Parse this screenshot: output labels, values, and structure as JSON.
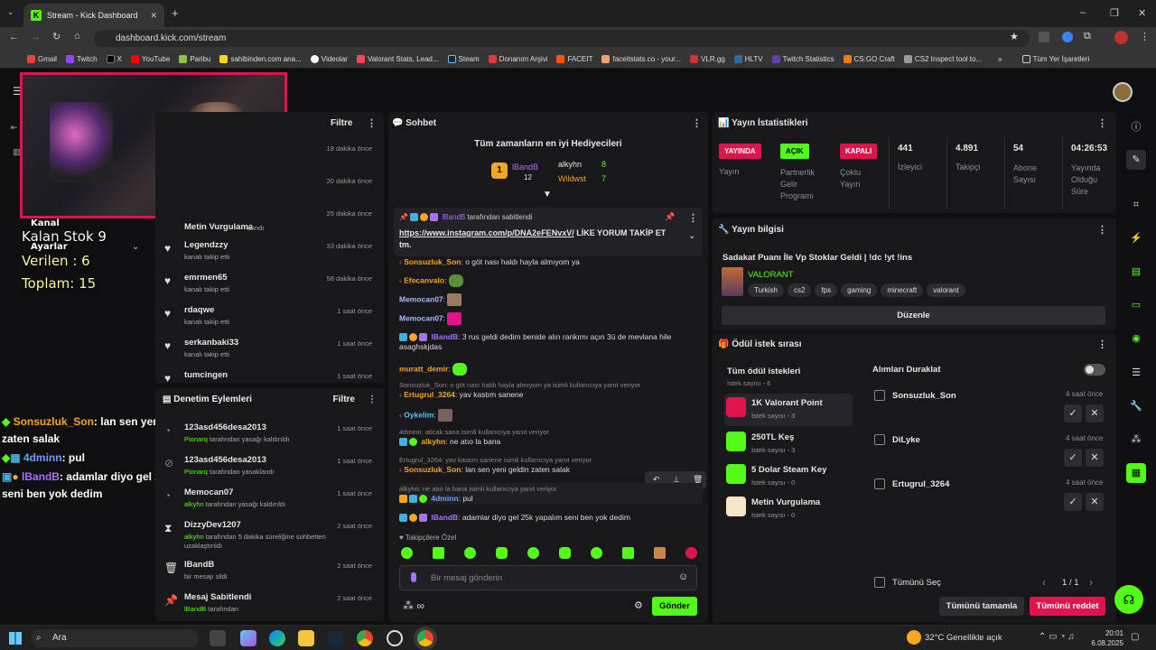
{
  "browser": {
    "tab_title": "Stream - Kick Dashboard",
    "url": "dashboard.kick.com/stream",
    "bookmarks": [
      "Gmail",
      "Twitch",
      "X",
      "YouTube",
      "Paribu",
      "sahibinden.com ana...",
      "Videolar",
      "Valorant Stats, Lead...",
      "Steam",
      "Donanım Arşivi",
      "FACEIT",
      "faceitstats.co - your...",
      "VLR.gg",
      "HLTV",
      "Twitch Statistics",
      "CS:GO Craft",
      "CS2 Inspect tool to..."
    ],
    "all_bookmarks": "Tüm Yer İşaretleri"
  },
  "overlay": {
    "kanal": "Kanal",
    "ayarlar": "Ayarlar",
    "kalan": "Kalan Stok 9",
    "verilen": "Verilen :  6",
    "toplam": "Toplam: 15",
    "chat": [
      {
        "user": "Sonsuzluk_Son",
        "msg": ": lan sen yeni geldin zaten salak"
      },
      {
        "user": "4dminn",
        "msg": ": pul"
      },
      {
        "user": "lBandB",
        "msg": ": adamlar diyo gel 25k yapalım seni ben yok dedim"
      }
    ]
  },
  "activity": {
    "filter": "Filtre",
    "rows": [
      {
        "name": "",
        "sub": "",
        "time": "18 dakika önce"
      },
      {
        "name": "",
        "sub": "",
        "time": "20 dakika önce"
      },
      {
        "name": "",
        "sub": "",
        "time": "25 dakika önce"
      },
      {
        "name": "Metin Vurgulama",
        "sub": "alındı",
        "time": ""
      },
      {
        "name": "Legendzzy",
        "sub": "kanalı takip etti",
        "time": "33 dakika önce"
      },
      {
        "name": "emrmen65",
        "sub": "kanalı takip etti",
        "time": "58 dakika önce"
      },
      {
        "name": "rdaqwe",
        "sub": "kanalı takip etti",
        "time": "1 saat önce"
      },
      {
        "name": "serkanbaki33",
        "sub": "kanalı takip etti",
        "time": "1 saat önce"
      },
      {
        "name": "tumcingen",
        "sub": "",
        "time": "1 saat önce"
      }
    ]
  },
  "moderation": {
    "title": "Denetim Eylemleri",
    "filter": "Filtre",
    "rows": [
      {
        "name": "123asd456desa2013",
        "actor": "Pionarq",
        "sub": " tarafından yasağı kaldırıldı",
        "time": "1 saat önce"
      },
      {
        "name": "123asd456desa2013",
        "actor": "Pionarq",
        "sub": " tarafından yasaklandı",
        "time": "1 saat önce"
      },
      {
        "name": "Memocan07",
        "actor": "alkyhn",
        "sub": " tarafından yasağı kaldırıldı",
        "time": "1 saat önce"
      },
      {
        "name": "DizzyDev1207",
        "actor": "alkyhn",
        "sub": " tarafından 5 dakika süreliğine sohbetten uzaklaştırıldı",
        "time": "2 saat önce"
      },
      {
        "name": "lBandB",
        "actor": "",
        "sub": "bir mesajı sildi",
        "time": "2 saat önce"
      },
      {
        "name": "Mesaj Sabitlendi",
        "actor": "lBandB",
        "sub": " tarafından",
        "time": "2 saat önce"
      }
    ]
  },
  "chat": {
    "title": "Sohbet",
    "gifters_title": "Tüm zamanların en iyi Hediyecileri",
    "gifter1": "lBandB",
    "gifter1_count": "12",
    "gifter2": "alkyhn",
    "gifter2_count": "8",
    "gifter3": "Wildwst",
    "gifter3_count": "7",
    "pinned_by": "lBandB",
    "pinned_suffix": " tarafından sabitlendi",
    "pinned_link": "https://www.instagram.com/p/DNA2eFENvxV/",
    "pinned_text": " LİKE YORUM TAKİP ET tm.",
    "messages": [
      {
        "reply": "",
        "user": "Sonsuzluk_Son",
        "text": ": o göt nası haldı hayla almıyom ya"
      },
      {
        "reply": "",
        "user": "Efecanvalo",
        "text": ":"
      },
      {
        "reply": "",
        "user": "Memocan07",
        "text": ":"
      },
      {
        "reply": "",
        "user": "Memocan07",
        "text": ":"
      },
      {
        "reply": "",
        "user": "lBandB",
        "text": ": 3 rus geldi dedim benide alın rankımı açın 3ü de mevlana hile asaghskjdas"
      },
      {
        "reply": "",
        "user": "muratt_demir",
        "text": ":"
      },
      {
        "reply": "Sonsuzluk_Son: o göt nası haldı hayla almıyom ya isimli kullanıcıya yanıt veriyor",
        "user": "Ertugrul_3264",
        "text": ": yav kastım sanene"
      },
      {
        "reply": "",
        "user": "Oykelim",
        "text": ":"
      },
      {
        "reply": "4dminn: aticak sana isimli kullanıcıya yanıt veriyor",
        "user": "alkyhn",
        "text": ": ne atıo la bana"
      },
      {
        "reply": "Ertugrul_3264: yav kastım sanene isimli kullanıcıya yanıt veriyor",
        "user": "Sonsuzluk_Son",
        "text": ": lan sen yeni geldin zaten salak"
      },
      {
        "reply": "alkyhn: ne atıo la bana isimli kullanıcıya yanıt veriyor",
        "user": "4dminn",
        "text": ": pul"
      },
      {
        "reply": "",
        "user": "lBandB",
        "text": ": adamlar diyo gel 25k yapalım seni ben yok dedim"
      }
    ],
    "followers_only": "Takipçilere Özel",
    "input_placeholder": "Bir mesaj gönderin",
    "send": "Gönder"
  },
  "stats": {
    "title": "Yayın İstatistikleri",
    "items": [
      {
        "pill": "YAYINDA",
        "label": "Yayın"
      },
      {
        "pill": "AÇIK",
        "label": "Partnerlik Gelir Programı"
      },
      {
        "pill": "KAPALI",
        "label": "Çoklu Yayın"
      },
      {
        "value": "441",
        "label": "İzleyici"
      },
      {
        "value": "4.891",
        "label": "Takipçi"
      },
      {
        "value": "54",
        "label": "Abone Sayısı"
      },
      {
        "value": "04:26:53",
        "label": "Yayında Olduğu Süre"
      }
    ]
  },
  "info": {
    "title": "Yayın bilgisi",
    "stream_title": "Sadakat Puanı İle Vp Stoklar Geldi | !dc !yt !ins",
    "category": "VALORANT",
    "tags": [
      "Turkish",
      "cs2",
      "fps",
      "gaming",
      "minecraft",
      "valorant"
    ],
    "edit": "Düzenle"
  },
  "rewards": {
    "title": "Ödül istek sırası",
    "all": "Tüm ödül istekleri",
    "all_count": "İstek sayısı - 6",
    "pause": "Alımları Duraklat",
    "items": [
      {
        "name": "1K Valorant Point",
        "count": "İstek sayısı - 3"
      },
      {
        "name": "250TL Keş",
        "count": "İstek sayısı - 3"
      },
      {
        "name": "5 Dolar Steam Key",
        "count": "İstek sayısı - 0"
      },
      {
        "name": "Metin Vurgulama",
        "count": "İstek sayısı - 0"
      }
    ],
    "requests": [
      {
        "user": "Sonsuzluk_Son",
        "time": "4 saat önce",
        "color": "#f5a623"
      },
      {
        "user": "DiLyke",
        "time": "4 saat önce",
        "color": "#6f9dff"
      },
      {
        "user": "Ertugrul_3264",
        "time": "4 saat önce",
        "color": "#c86bff"
      }
    ],
    "select_all": "Tümünü Seç",
    "page": "1 / 1",
    "complete_all": "Tümünü tamamla",
    "reject_all": "Tümünü reddet"
  },
  "taskbar": {
    "search": "Ara",
    "weather": "32°C  Genellikle açık",
    "time": "20:01",
    "date": "6.08.2025"
  },
  "colors": {
    "kick_green": "#53fc18",
    "red": "#e0144c",
    "purple": "#a970ff"
  }
}
